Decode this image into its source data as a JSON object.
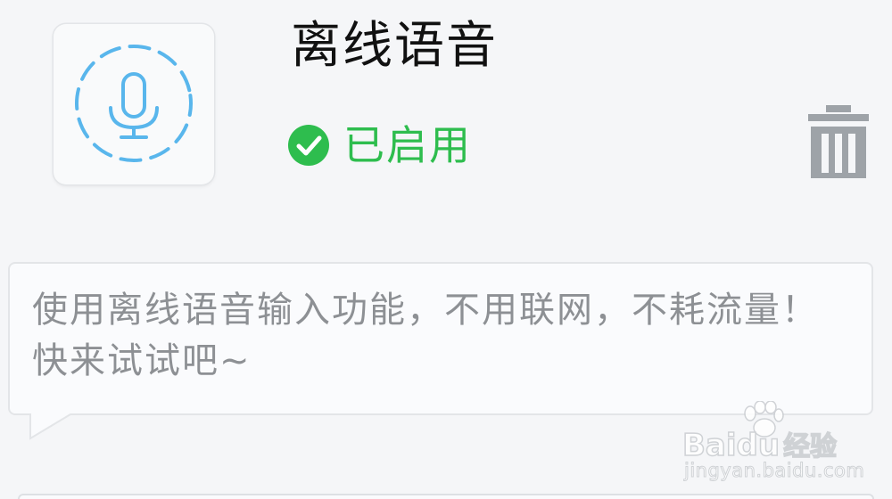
{
  "plugin": {
    "title": "离线语音",
    "status_label": "已启用",
    "description": "使用离线语音输入功能，不用联网，不耗流量！快来试试吧~",
    "icon": "microphone-icon",
    "status_icon": "check-circle-icon",
    "delete_icon": "trash-icon"
  },
  "watermark": {
    "brand_latin": "Baidu",
    "brand_cn": "经验",
    "url": "jingyan.baidu.com"
  },
  "colors": {
    "accent_blue": "#59b6ec",
    "status_green": "#2ebd4e",
    "delete_gray": "#9ea3a8",
    "title": "#111111",
    "description": "#8d9094"
  }
}
